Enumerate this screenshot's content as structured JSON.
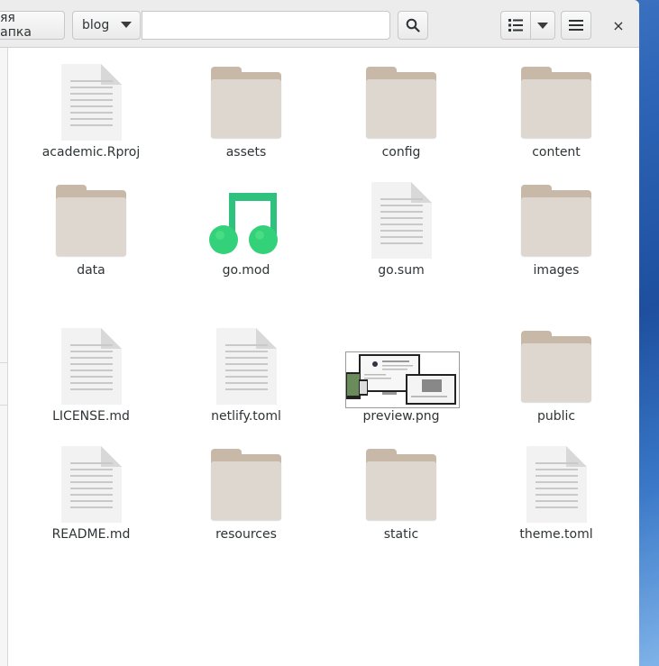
{
  "toolbar": {
    "breadcrumb_previous": "ляя папка",
    "breadcrumb_current": "blog",
    "search_placeholder": "",
    "search_icon": "search-icon",
    "list_view_icon": "list-view-icon",
    "view_options_icon": "chevron-down-icon",
    "menu_icon": "hamburger-menu-icon",
    "close_label": "×"
  },
  "files": [
    {
      "name": "academic.Rproj",
      "type": "text-file"
    },
    {
      "name": "assets",
      "type": "folder"
    },
    {
      "name": "config",
      "type": "folder"
    },
    {
      "name": "content",
      "type": "folder"
    },
    {
      "name": "data",
      "type": "folder"
    },
    {
      "name": "go.mod",
      "type": "audio-file"
    },
    {
      "name": "go.sum",
      "type": "text-file"
    },
    {
      "name": "images",
      "type": "folder"
    },
    {
      "name": "LICENSE.md",
      "type": "text-file"
    },
    {
      "name": "netlify.toml",
      "type": "text-file"
    },
    {
      "name": "preview.png",
      "type": "image-thumbnail"
    },
    {
      "name": "public",
      "type": "folder"
    },
    {
      "name": "README.md",
      "type": "text-file"
    },
    {
      "name": "resources",
      "type": "folder"
    },
    {
      "name": "static",
      "type": "folder"
    },
    {
      "name": "theme.toml",
      "type": "text-file"
    }
  ],
  "colors": {
    "folder_front": "#ded7cf",
    "folder_back": "#c7b8a7",
    "music_green": "#33d17a",
    "headerbar": "#ececec"
  }
}
